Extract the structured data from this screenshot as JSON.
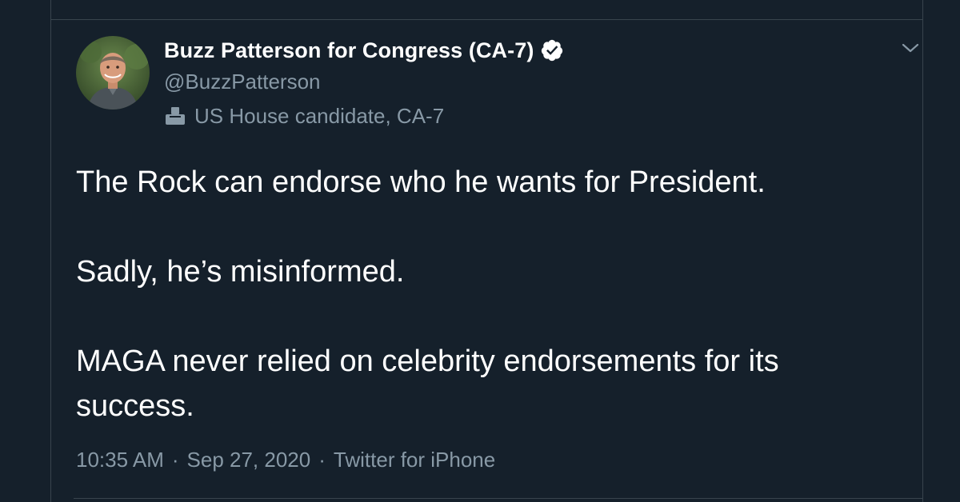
{
  "tweet": {
    "author": {
      "display_name": "Buzz Patterson for Congress (CA-7)",
      "handle": "@BuzzPatterson",
      "verified_icon": "verified-badge-icon",
      "label": "US House candidate, CA-7",
      "label_icon": "ballot-box-icon"
    },
    "menu_icon": "chevron-down-icon",
    "paragraphs": [
      "The Rock can endorse who he wants for President.",
      "Sadly, he’s misinformed.",
      "MAGA never relied on celebrity endorsements for its success."
    ],
    "time": "10:35 AM",
    "separator": "·",
    "date": "Sep 27, 2020",
    "source": "Twitter for iPhone"
  },
  "colors": {
    "background": "#15202b",
    "border": "#38444d",
    "primary_text": "#ffffff",
    "secondary_text": "#8899a6"
  }
}
